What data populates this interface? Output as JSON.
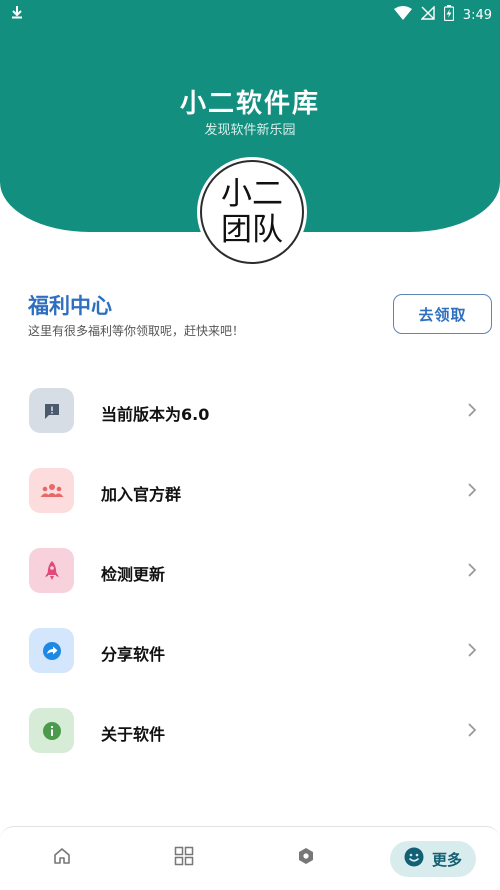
{
  "status_bar": {
    "time": "3:49",
    "icons": [
      "download-icon",
      "wifi-icon",
      "no-signal-icon",
      "battery-charging-icon"
    ]
  },
  "header": {
    "title": "小二软件库",
    "subtitle": "发现软件新乐园",
    "logo_line1": "小二",
    "logo_line2": "团队",
    "color": "#138f7f"
  },
  "welfare": {
    "title": "福利中心",
    "description": "这里有很多福利等你领取呢，赶快来吧！",
    "button_label": "去领取",
    "accent": "#2f6fc0"
  },
  "menu": {
    "items": [
      {
        "label": "当前版本为6.0",
        "icon": "message-alert-icon",
        "bg": "#d7dde5",
        "fg": "#4b5a6c"
      },
      {
        "label": "加入官方群",
        "icon": "group-icon",
        "bg": "#fcdcdc",
        "fg": "#e56969"
      },
      {
        "label": "检测更新",
        "icon": "rocket-icon",
        "bg": "#f7d2dd",
        "fg": "#e14b7a"
      },
      {
        "label": "分享软件",
        "icon": "share-icon",
        "bg": "#d4e6fb",
        "fg": "#1e88e5"
      },
      {
        "label": "关于软件",
        "icon": "info-icon",
        "bg": "#d7ecd7",
        "fg": "#4c9a4c"
      }
    ]
  },
  "bottom_nav": {
    "items": [
      "home-icon",
      "grid-icon",
      "location-icon"
    ],
    "more_label": "更多",
    "more_icon": "smile-icon"
  }
}
